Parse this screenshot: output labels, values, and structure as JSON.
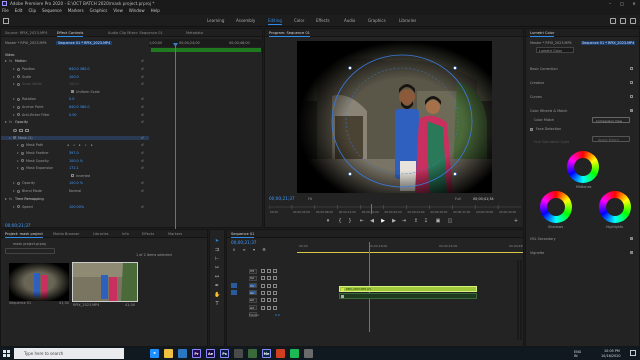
{
  "titlebar": {
    "title": "Adobe Premiere Pro 2020 - E:\\OCT BATCH 2020\\mask project.prproj *"
  },
  "menubar": {
    "items": [
      "File",
      "Edit",
      "Clip",
      "Sequence",
      "Markers",
      "Graphics",
      "View",
      "Window",
      "Help"
    ]
  },
  "workspaces": {
    "tabs": [
      "Learning",
      "Assembly",
      "Editing",
      "Color",
      "Effects",
      "Audio",
      "Graphics",
      "Libraries"
    ],
    "active": "Editing"
  },
  "source_panel": {
    "tabs": [
      "Source: RPIX_2023.MP4",
      "Effect Controls",
      "Audio Clip Mixer: Sequence 01",
      "Metadata"
    ],
    "active": "Effect Controls"
  },
  "effect_controls": {
    "master": "Master * RPIX_2023.MP4",
    "sequence": "Sequence 01 * RPIX_2023.MP4",
    "ruler_start": "1;00;00",
    "ruler_mark": "00;00;24;00",
    "ruler_mark2": "00;00;48;00",
    "video_label": "Video",
    "rows": [
      {
        "name": "Motion",
        "value": "",
        "indent": 0,
        "type": "group"
      },
      {
        "name": "Position",
        "value": "640.0   360.0",
        "indent": 2,
        "type": "param"
      },
      {
        "name": "Scale",
        "value": "100.0",
        "indent": 2,
        "type": "param"
      },
      {
        "name": "Scale Width",
        "value": "100.0",
        "indent": 2,
        "type": "param-dim"
      },
      {
        "name": "",
        "value": "Uniform Scale",
        "indent": 2,
        "type": "check"
      },
      {
        "name": "Rotation",
        "value": "0.0",
        "indent": 2,
        "type": "param"
      },
      {
        "name": "Anchor Point",
        "value": "640.0   360.0",
        "indent": 2,
        "type": "param"
      },
      {
        "name": "Anti-flicker Filter",
        "value": "0.00",
        "indent": 2,
        "type": "param"
      },
      {
        "name": "Opacity",
        "value": "",
        "indent": 0,
        "type": "group"
      },
      {
        "name": "",
        "value": "",
        "indent": 2,
        "type": "masktools"
      },
      {
        "name": "Mask (1)",
        "value": "",
        "indent": 1,
        "type": "mask"
      },
      {
        "name": "Mask Path",
        "value": "",
        "indent": 3,
        "type": "maskpath"
      },
      {
        "name": "Mask Feather",
        "value": "397.0",
        "indent": 3,
        "type": "param"
      },
      {
        "name": "Mask Opacity",
        "value": "100.0 %",
        "indent": 3,
        "type": "param"
      },
      {
        "name": "Mask Expansion",
        "value": "172.1",
        "indent": 3,
        "type": "param"
      },
      {
        "name": "",
        "value": "Inverted",
        "indent": 3,
        "type": "check"
      },
      {
        "name": "Opacity",
        "value": "100.0 %",
        "indent": 2,
        "type": "param"
      },
      {
        "name": "Blend Mode",
        "value": "Normal",
        "indent": 2,
        "type": "dropdown"
      },
      {
        "name": "Time Remapping",
        "value": "",
        "indent": 0,
        "type": "group"
      },
      {
        "name": "Speed",
        "value": "100.00%",
        "indent": 2,
        "type": "param"
      }
    ],
    "timecode": "00;00;21;37"
  },
  "program": {
    "title": "Program: Sequence 01",
    "timecode": "00;00;21;37",
    "fit": "Fit",
    "quality": "Full",
    "duration": "00;00;41;34",
    "ruler_labels": [
      "00;00",
      "00;00;04;00",
      "00;00;08;00",
      "00;00;12;00",
      "00;00;16;00",
      "00;00;20;00",
      "00;00;24;00",
      "00;00;28;00",
      "00;00;32;00",
      "00;00;36;00",
      "00;00;40;00"
    ]
  },
  "lumetri": {
    "title": "Lumetri Color",
    "master": "Master * RPIX_2023.MP4",
    "sequence": "Sequence 01 * RPIX_2023.MP4",
    "effect": "Lumetri Color",
    "sections": [
      "Basic Correction",
      "Creative",
      "Curves",
      "Color Wheels & Match"
    ],
    "color_match": "Color Match",
    "comparison_btn": "Comparison View",
    "face_detection": "Face Detection",
    "apply_match": "Apply Match",
    "hsl_label": "Hue Saturation Light",
    "wheels": {
      "midtones": "Midtones",
      "shadows": "Shadows",
      "highlights": "Highlights"
    },
    "bottom_sections": [
      "HSL Secondary",
      "Vignette"
    ]
  },
  "project": {
    "tabs": [
      "Project: mask project",
      "Media Browser",
      "Libraries",
      "Info",
      "Effects",
      "Markers"
    ],
    "active": "Project: mask project",
    "file": "mask project.prproj",
    "count": "1 of 2 items selected",
    "items": [
      {
        "name": "Sequence 01",
        "duration": "41;34"
      },
      {
        "name": "RPIX_2023.MP4",
        "duration": "41;34"
      }
    ]
  },
  "timeline": {
    "tab": "Sequence 01",
    "timecode": "00;00;21;37",
    "ruler": [
      "00;00",
      "00;00;16;00",
      "00;00;32;00",
      "00;00;48;00"
    ],
    "tracks": [
      "V3",
      "V2",
      "V1",
      "A1",
      "A2",
      "A3",
      "Master"
    ],
    "master_value": "0.0",
    "clip_label": "RPIX_2023.MP4 [V]"
  },
  "taskbar": {
    "search_placeholder": "Type here to search",
    "time": "10:05 PM",
    "date": "10/16/2020",
    "lang": "ENG",
    "region": "IN",
    "apps": [
      {
        "label": "e",
        "color": "#1e90ff"
      },
      {
        "label": "",
        "color": "#f0c040"
      },
      {
        "label": "",
        "color": "#2b78c2"
      },
      {
        "label": "Pr",
        "color": "#2a0a4a"
      },
      {
        "label": "Ae",
        "color": "#1a0a3a"
      },
      {
        "label": "Ps",
        "color": "#0a1e3a"
      },
      {
        "label": "",
        "color": "#4a4a4a"
      },
      {
        "label": "",
        "color": "#3a6a3a"
      },
      {
        "label": "Me",
        "color": "#0a2a3a"
      },
      {
        "label": "",
        "color": "#d04020"
      },
      {
        "label": "",
        "color": "#1db954"
      },
      {
        "label": "",
        "color": "#6a6a6a"
      }
    ]
  },
  "colors": {
    "accent": "#2d8ceb",
    "panel": "#232323",
    "clip_green": "#9ec83a"
  }
}
